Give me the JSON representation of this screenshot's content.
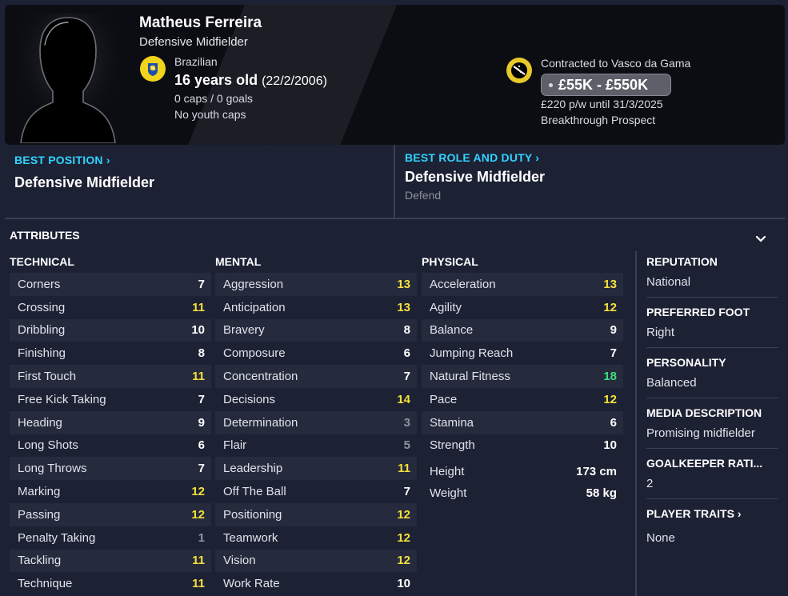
{
  "header": {
    "name": "Matheus Ferreira",
    "position": "Defensive Midfielder",
    "nationality": "Brazilian",
    "age": "16 years old",
    "dob": "(22/2/2006)",
    "caps": "0 caps / 0 goals",
    "youth_caps": "No youth caps",
    "contract": "Contracted to Vasco da Gama",
    "value": "£55K - £550K",
    "wage": "£220 p/w until 31/3/2025",
    "status": "Breakthrough Prospect"
  },
  "best_position": {
    "label": "BEST POSITION",
    "value": "Defensive Midfielder"
  },
  "best_role": {
    "label": "BEST ROLE AND DUTY",
    "value": "Defensive Midfielder",
    "duty": "Defend"
  },
  "attributes": {
    "title": "ATTRIBUTES",
    "technical": {
      "heading": "TECHNICAL",
      "items": [
        {
          "name": "Corners",
          "value": "7"
        },
        {
          "name": "Crossing",
          "value": "11"
        },
        {
          "name": "Dribbling",
          "value": "10"
        },
        {
          "name": "Finishing",
          "value": "8"
        },
        {
          "name": "First Touch",
          "value": "11"
        },
        {
          "name": "Free Kick Taking",
          "value": "7"
        },
        {
          "name": "Heading",
          "value": "9"
        },
        {
          "name": "Long Shots",
          "value": "6"
        },
        {
          "name": "Long Throws",
          "value": "7"
        },
        {
          "name": "Marking",
          "value": "12"
        },
        {
          "name": "Passing",
          "value": "12"
        },
        {
          "name": "Penalty Taking",
          "value": "1"
        },
        {
          "name": "Tackling",
          "value": "11"
        },
        {
          "name": "Technique",
          "value": "11"
        }
      ]
    },
    "mental": {
      "heading": "MENTAL",
      "items": [
        {
          "name": "Aggression",
          "value": "13"
        },
        {
          "name": "Anticipation",
          "value": "13"
        },
        {
          "name": "Bravery",
          "value": "8"
        },
        {
          "name": "Composure",
          "value": "6"
        },
        {
          "name": "Concentration",
          "value": "7"
        },
        {
          "name": "Decisions",
          "value": "14"
        },
        {
          "name": "Determination",
          "value": "3"
        },
        {
          "name": "Flair",
          "value": "5"
        },
        {
          "name": "Leadership",
          "value": "11"
        },
        {
          "name": "Off The Ball",
          "value": "7"
        },
        {
          "name": "Positioning",
          "value": "12"
        },
        {
          "name": "Teamwork",
          "value": "12"
        },
        {
          "name": "Vision",
          "value": "12"
        },
        {
          "name": "Work Rate",
          "value": "10"
        }
      ]
    },
    "physical": {
      "heading": "PHYSICAL",
      "items": [
        {
          "name": "Acceleration",
          "value": "13"
        },
        {
          "name": "Agility",
          "value": "12"
        },
        {
          "name": "Balance",
          "value": "9"
        },
        {
          "name": "Jumping Reach",
          "value": "7"
        },
        {
          "name": "Natural Fitness",
          "value": "18"
        },
        {
          "name": "Pace",
          "value": "12"
        },
        {
          "name": "Stamina",
          "value": "6"
        },
        {
          "name": "Strength",
          "value": "10"
        }
      ],
      "height_label": "Height",
      "height": "173 cm",
      "weight_label": "Weight",
      "weight": "58 kg"
    }
  },
  "side": {
    "reputation_label": "REPUTATION",
    "reputation": "National",
    "foot_label": "PREFERRED FOOT",
    "foot": "Right",
    "personality_label": "PERSONALITY",
    "personality": "Balanced",
    "media_label": "MEDIA DESCRIPTION",
    "media": "Promising midfielder",
    "gk_label": "GOALKEEPER RATI...",
    "gk": "2",
    "traits_label": "PLAYER TRAITS",
    "traits": "None"
  },
  "colors": {
    "accent": "#2fd4ff",
    "high": "#3ee07a",
    "good": "#f5e13c",
    "mid": "#ffffff",
    "low": "#8e93a0"
  }
}
